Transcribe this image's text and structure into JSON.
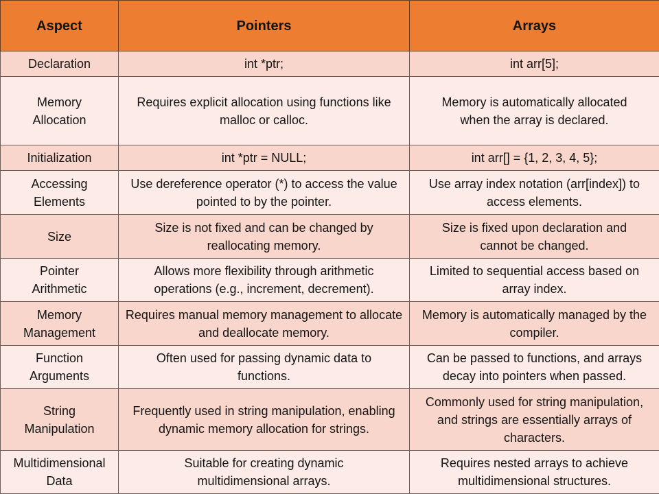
{
  "table": {
    "headers": [
      "Aspect",
      "Pointers",
      "Arrays"
    ],
    "rows": [
      {
        "aspect": "Declaration",
        "pointers": "int *ptr;",
        "arrays": "int arr[5];"
      },
      {
        "aspect": "Memory Allocation",
        "pointers": "Requires explicit allocation using functions like malloc or calloc.",
        "arrays": "Memory is automatically allocated when the array is declared."
      },
      {
        "aspect": "Initialization",
        "pointers": "int *ptr = NULL;",
        "arrays": "int arr[] = {1, 2, 3, 4, 5};"
      },
      {
        "aspect": "Accessing Elements",
        "pointers": "Use dereference  operator (*) to access the value pointed to by the pointer.",
        "arrays": "Use array index notation (arr[index]) to access elements."
      },
      {
        "aspect": "Size",
        "pointers": "Size is not fixed and can be changed by reallocating memory.",
        "arrays": "Size is fixed upon declaration and cannot be changed."
      },
      {
        "aspect": "Pointer Arithmetic",
        "pointers": "Allows more flexibility through arithmetic operations (e.g., increment, decrement).",
        "arrays": "Limited to sequential access based on array index."
      },
      {
        "aspect": "Memory Management",
        "pointers": "Requires manual memory management to allocate and deallocate memory.",
        "arrays": "Memory is automatically managed by the compiler."
      },
      {
        "aspect": "Function Arguments",
        "pointers": "Often used for passing dynamic data to functions.",
        "arrays": "Can be passed to functions, and arrays decay into pointers when passed."
      },
      {
        "aspect": "String Manipulation",
        "pointers": "Frequently used in string manipulation, enabling dynamic memory allocation for strings.",
        "arrays": "Commonly used for string manipulation, and strings are essentially arrays of characters."
      },
      {
        "aspect": "Multidimensional Data",
        "pointers": "Suitable for creating dynamic multidimensional arrays.",
        "arrays": "Requires nested arrays to achieve multidimensional structures."
      }
    ]
  },
  "colors": {
    "header": "#ed7d31",
    "row_dark": "#f8d6cb",
    "row_light": "#fcebe6"
  }
}
